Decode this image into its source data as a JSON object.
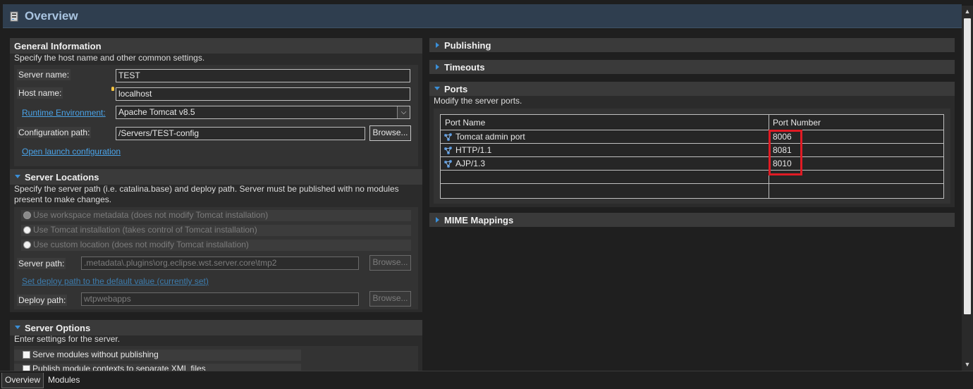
{
  "header": {
    "title": "Overview",
    "icon": "server-editor-icon"
  },
  "general": {
    "title": "General Information",
    "description": "Specify the host name and other common settings.",
    "server_name_label": "Server name:",
    "server_name_value": "TEST",
    "host_name_label": "Host name:",
    "host_name_value": "localhost",
    "runtime_label": "Runtime Environment:",
    "runtime_value": "Apache Tomcat v8.5",
    "config_path_label": "Configuration path:",
    "config_path_value": "/Servers/TEST-config",
    "browse_label": "Browse...",
    "open_launch_label": "Open launch configuration"
  },
  "locations": {
    "title": "Server Locations",
    "description": "Specify the server path (i.e. catalina.base) and deploy path. Server must be published with no modules present to make changes.",
    "options": [
      "Use workspace metadata (does not modify Tomcat installation)",
      "Use Tomcat installation (takes control of Tomcat installation)",
      "Use custom location (does not modify Tomcat installation)"
    ],
    "server_path_label": "Server path:",
    "server_path_value": ".metadata\\.plugins\\org.eclipse.wst.server.core\\tmp2",
    "browse_label": "Browse...",
    "set_deploy_label": "Set deploy path to the default value (currently set)",
    "deploy_path_label": "Deploy path:",
    "deploy_path_value": "wtpwebapps"
  },
  "server_options": {
    "title": "Server Options",
    "description": "Enter settings for the server.",
    "options": [
      "Serve modules without publishing",
      "Publish module contexts to separate XML files"
    ]
  },
  "right": {
    "publishing_title": "Publishing",
    "timeouts_title": "Timeouts",
    "ports_title": "Ports",
    "ports_description": "Modify the server ports.",
    "ports_columns": [
      "Port Name",
      "Port Number"
    ],
    "ports": [
      {
        "name": "Tomcat admin port",
        "number": "8006"
      },
      {
        "name": "HTTP/1.1",
        "number": "8081"
      },
      {
        "name": "AJP/1.3",
        "number": "8010"
      }
    ],
    "mime_title": "MIME Mappings"
  },
  "tabs": [
    "Overview",
    "Modules"
  ],
  "colors": {
    "accent": "#3a8fd8",
    "highlight": "#e01b24",
    "link": "#4aa3e8"
  }
}
